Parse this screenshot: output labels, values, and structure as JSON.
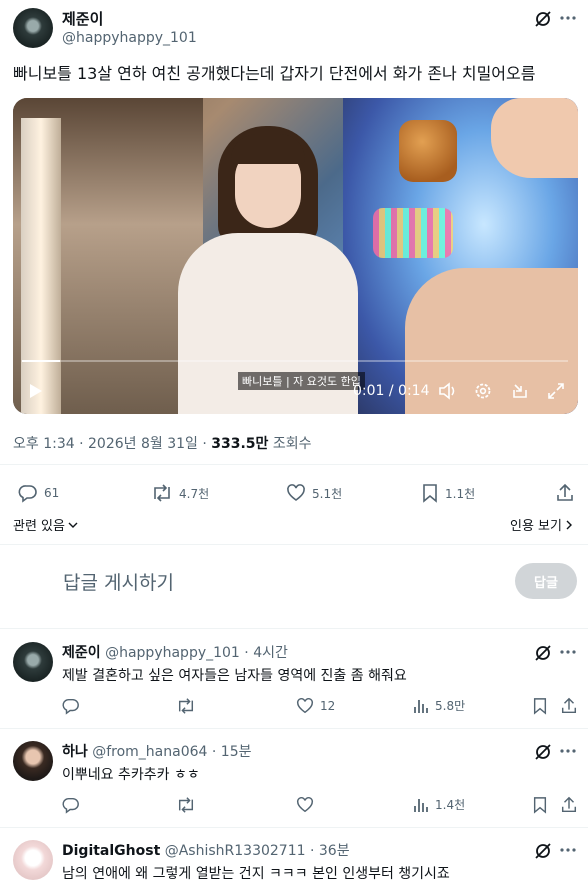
{
  "post": {
    "author_name": "제준이",
    "handle": "@happyhappy_101",
    "text": "빠니보틀 13살 연하 여친 공개했다는데 갑자기 단전에서 화가 존나 치밀어오름",
    "video": {
      "subtitle": "빠니보틀 | 자 요것도 한입",
      "time_label": "0:01 / 0:14",
      "progress": 0.07
    },
    "meta": {
      "time": "오후 1:34 · 2026년 8월 31일 · ",
      "views": "333.5만",
      "views_label": " 조회수"
    },
    "actions": {
      "replies": "61",
      "reposts": "4.7천",
      "likes": "5.1천",
      "bookmarks": "1.1천"
    },
    "related_label": "관련 있음",
    "quotes_label": "인용 보기"
  },
  "composer": {
    "placeholder": "답글 게시하기",
    "button": "답글"
  },
  "replies": [
    {
      "name": "제준이",
      "handle": "@happyhappy_101",
      "time": "· 4시간",
      "text": "제발 결혼하고 싶은 여자들은 남자들 영역에 진출 좀 해줘요",
      "likes": "12",
      "views": "5.8만"
    },
    {
      "name": "하나",
      "handle": "@from_hana064",
      "time": "· 15분",
      "text": "이뿌네요 추카추카 ㅎㅎ",
      "likes": "",
      "views": "1.4천"
    },
    {
      "name": "DigitalGhost",
      "handle": "@AshishR13302711",
      "time": "· 36분",
      "text": "남의 연애에 왜 그렇게 열받는 건지 ㅋㅋㅋ 본인 인생부터 챙기시죠"
    }
  ]
}
